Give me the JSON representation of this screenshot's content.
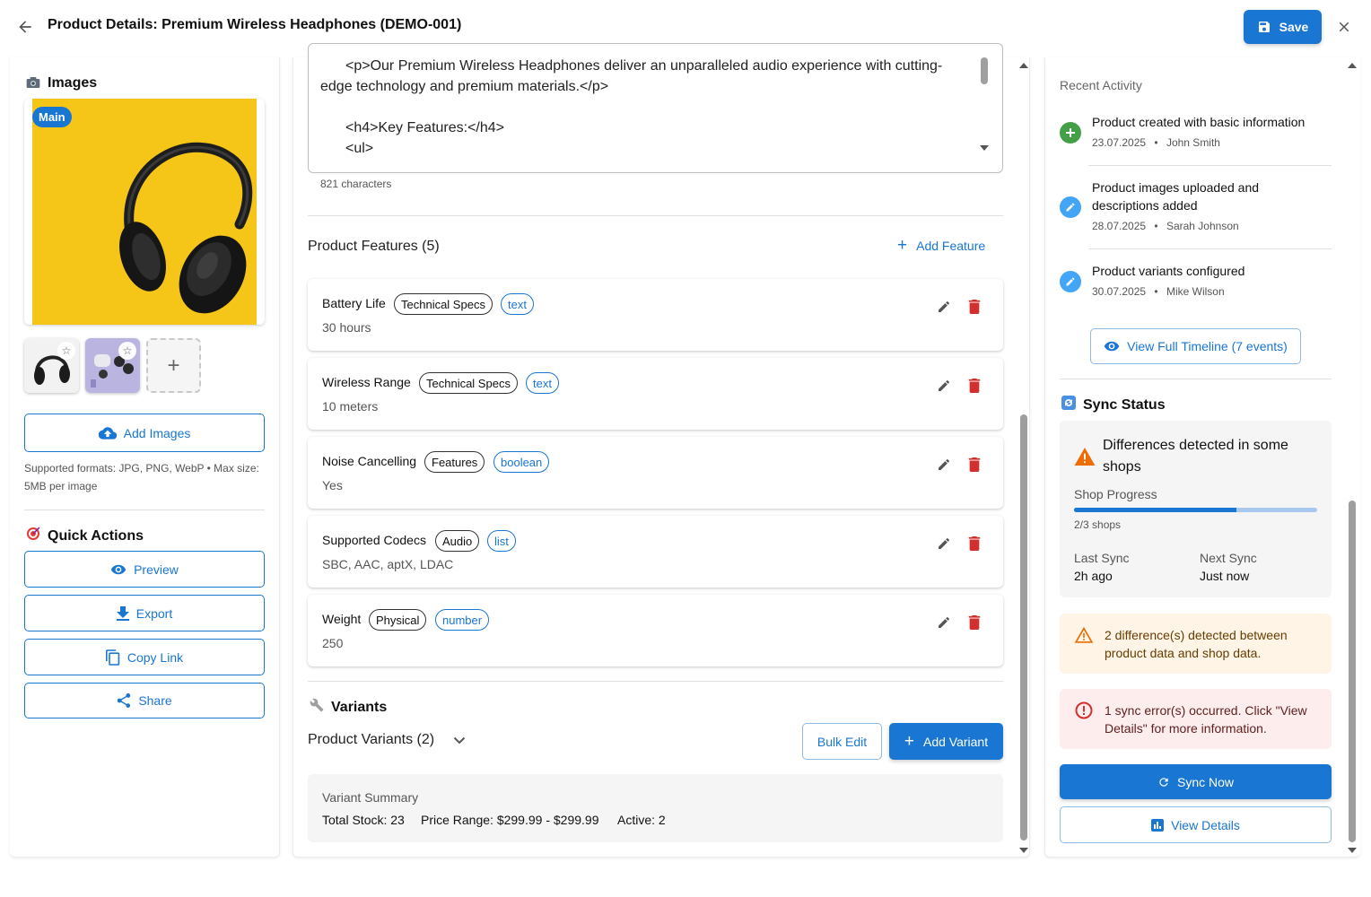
{
  "header": {
    "title": "Product Details: Premium Wireless Headphones (DEMO-001)",
    "save_label": "Save"
  },
  "images": {
    "title": "Images",
    "main_badge": "Main",
    "add_images_label": "Add Images",
    "hint": "Supported formats: JPG, PNG, WebP • Max size: 5MB per image",
    "add_thumb_symbol": "+"
  },
  "quick_actions": {
    "title": "Quick Actions",
    "items": [
      {
        "label": "Preview",
        "icon": "eye-icon"
      },
      {
        "label": "Export",
        "icon": "download-icon"
      },
      {
        "label": "Copy Link",
        "icon": "copy-icon"
      },
      {
        "label": "Share",
        "icon": "share-icon"
      }
    ]
  },
  "description": {
    "lines": [
      "<p>Our Premium Wireless Headphones deliver an unparalleled audio experience with cutting-",
      "edge technology and premium materials.</p>",
      "",
      "<h4>Key Features:</h4>",
      "<ul>"
    ],
    "char_count": "821 characters"
  },
  "features": {
    "title": "Product Features (5)",
    "add_label": "Add Feature",
    "items": [
      {
        "name": "Battery Life",
        "category": "Technical Specs",
        "type": "text",
        "value": "30 hours"
      },
      {
        "name": "Wireless Range",
        "category": "Technical Specs",
        "type": "text",
        "value": "10 meters"
      },
      {
        "name": "Noise Cancelling",
        "category": "Features",
        "type": "boolean",
        "value": "Yes"
      },
      {
        "name": "Supported Codecs",
        "category": "Audio",
        "type": "list",
        "value": "SBC, AAC, aptX, LDAC"
      },
      {
        "name": "Weight",
        "category": "Physical",
        "type": "number",
        "value": "250"
      }
    ]
  },
  "variants": {
    "title": "Variants",
    "subtitle": "Product Variants (2)",
    "bulk_edit_label": "Bulk Edit",
    "add_variant_label": "Add Variant",
    "summary_title": "Variant Summary",
    "total_stock": "Total Stock: 23",
    "price_range": "Price Range: $299.99 - $299.99",
    "active": "Active: 2"
  },
  "activity": {
    "title": "Recent Activity",
    "items": [
      {
        "text": "Product created with basic information",
        "date": "23.07.2025",
        "user": "John Smith",
        "icon": "plus-icon",
        "color": "#43a047"
      },
      {
        "text": "Product images uploaded and descriptions added",
        "date": "28.07.2025",
        "user": "Sarah Johnson",
        "icon": "pencil-icon",
        "color": "#42a5f5"
      },
      {
        "text": "Product variants configured",
        "date": "30.07.2025",
        "user": "Mike Wilson",
        "icon": "pencil-icon",
        "color": "#42a5f5"
      }
    ],
    "separator": "•",
    "timeline_label": "View Full Timeline (7 events)"
  },
  "sync": {
    "title": "Sync Status",
    "warning": "Differences detected in some shops",
    "progress_label": "Shop Progress",
    "progress_fraction": 0.667,
    "progress_text": "2/3 shops",
    "last_sync_label": "Last Sync",
    "last_sync_value": "2h ago",
    "next_sync_label": "Next Sync",
    "next_sync_value": "Just now",
    "diff_alert": "2 difference(s) detected between product data and shop data.",
    "error_alert": "1 sync error(s) occurred. Click \"View Details\" for more information.",
    "sync_now_label": "Sync Now",
    "view_details_label": "View Details"
  },
  "colors": {
    "primary": "#1976d2",
    "danger": "#d32f2f",
    "warning": "#ef6c00",
    "headphone_bg": "#f5c518"
  }
}
